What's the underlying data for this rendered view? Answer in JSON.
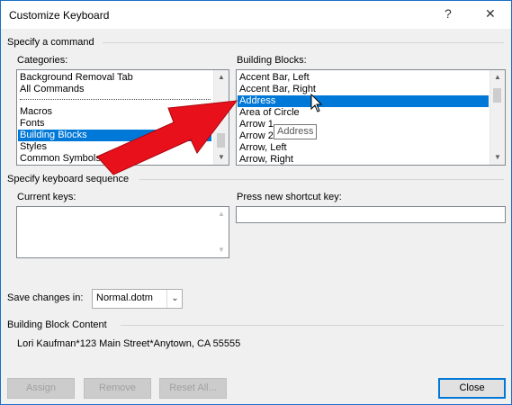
{
  "title": "Customize Keyboard",
  "title_buttons": {
    "help": "?",
    "close": "✕"
  },
  "specify_command": {
    "group_label": "Specify a command",
    "categories_label": "Categories:",
    "categories": [
      "Background Removal Tab",
      "All Commands",
      "",
      "Macros",
      "Fonts",
      "Building Blocks",
      "Styles",
      "Common Symbols"
    ],
    "categories_selected": "Building Blocks",
    "blocks_label": "Building Blocks:",
    "blocks": [
      "Accent Bar, Left",
      "Accent Bar, Right",
      "Address",
      "Area of Circle",
      "Arrow 1",
      "Arrow 2",
      "Arrow, Left",
      "Arrow, Right"
    ],
    "blocks_selected": "Address",
    "tooltip": "Address"
  },
  "keyboard_sequence": {
    "group_label": "Specify keyboard sequence",
    "current_keys_label": "Current keys:",
    "new_key_label": "Press new shortcut key:",
    "new_key_value": ""
  },
  "save_changes": {
    "label": "Save changes in:",
    "value": "Normal.dotm"
  },
  "building_block_content": {
    "label": "Building Block Content",
    "text": "Lori Kaufman*123 Main Street*Anytown, CA 55555"
  },
  "buttons": {
    "assign": "Assign",
    "remove": "Remove",
    "reset_all": "Reset All...",
    "close": "Close"
  },
  "colors": {
    "accent": "#0078d7",
    "arrow_red": "#e8101a"
  },
  "icons": {
    "annotation": "red-arrow-icon",
    "pointer": "mouse-cursor-icon"
  }
}
